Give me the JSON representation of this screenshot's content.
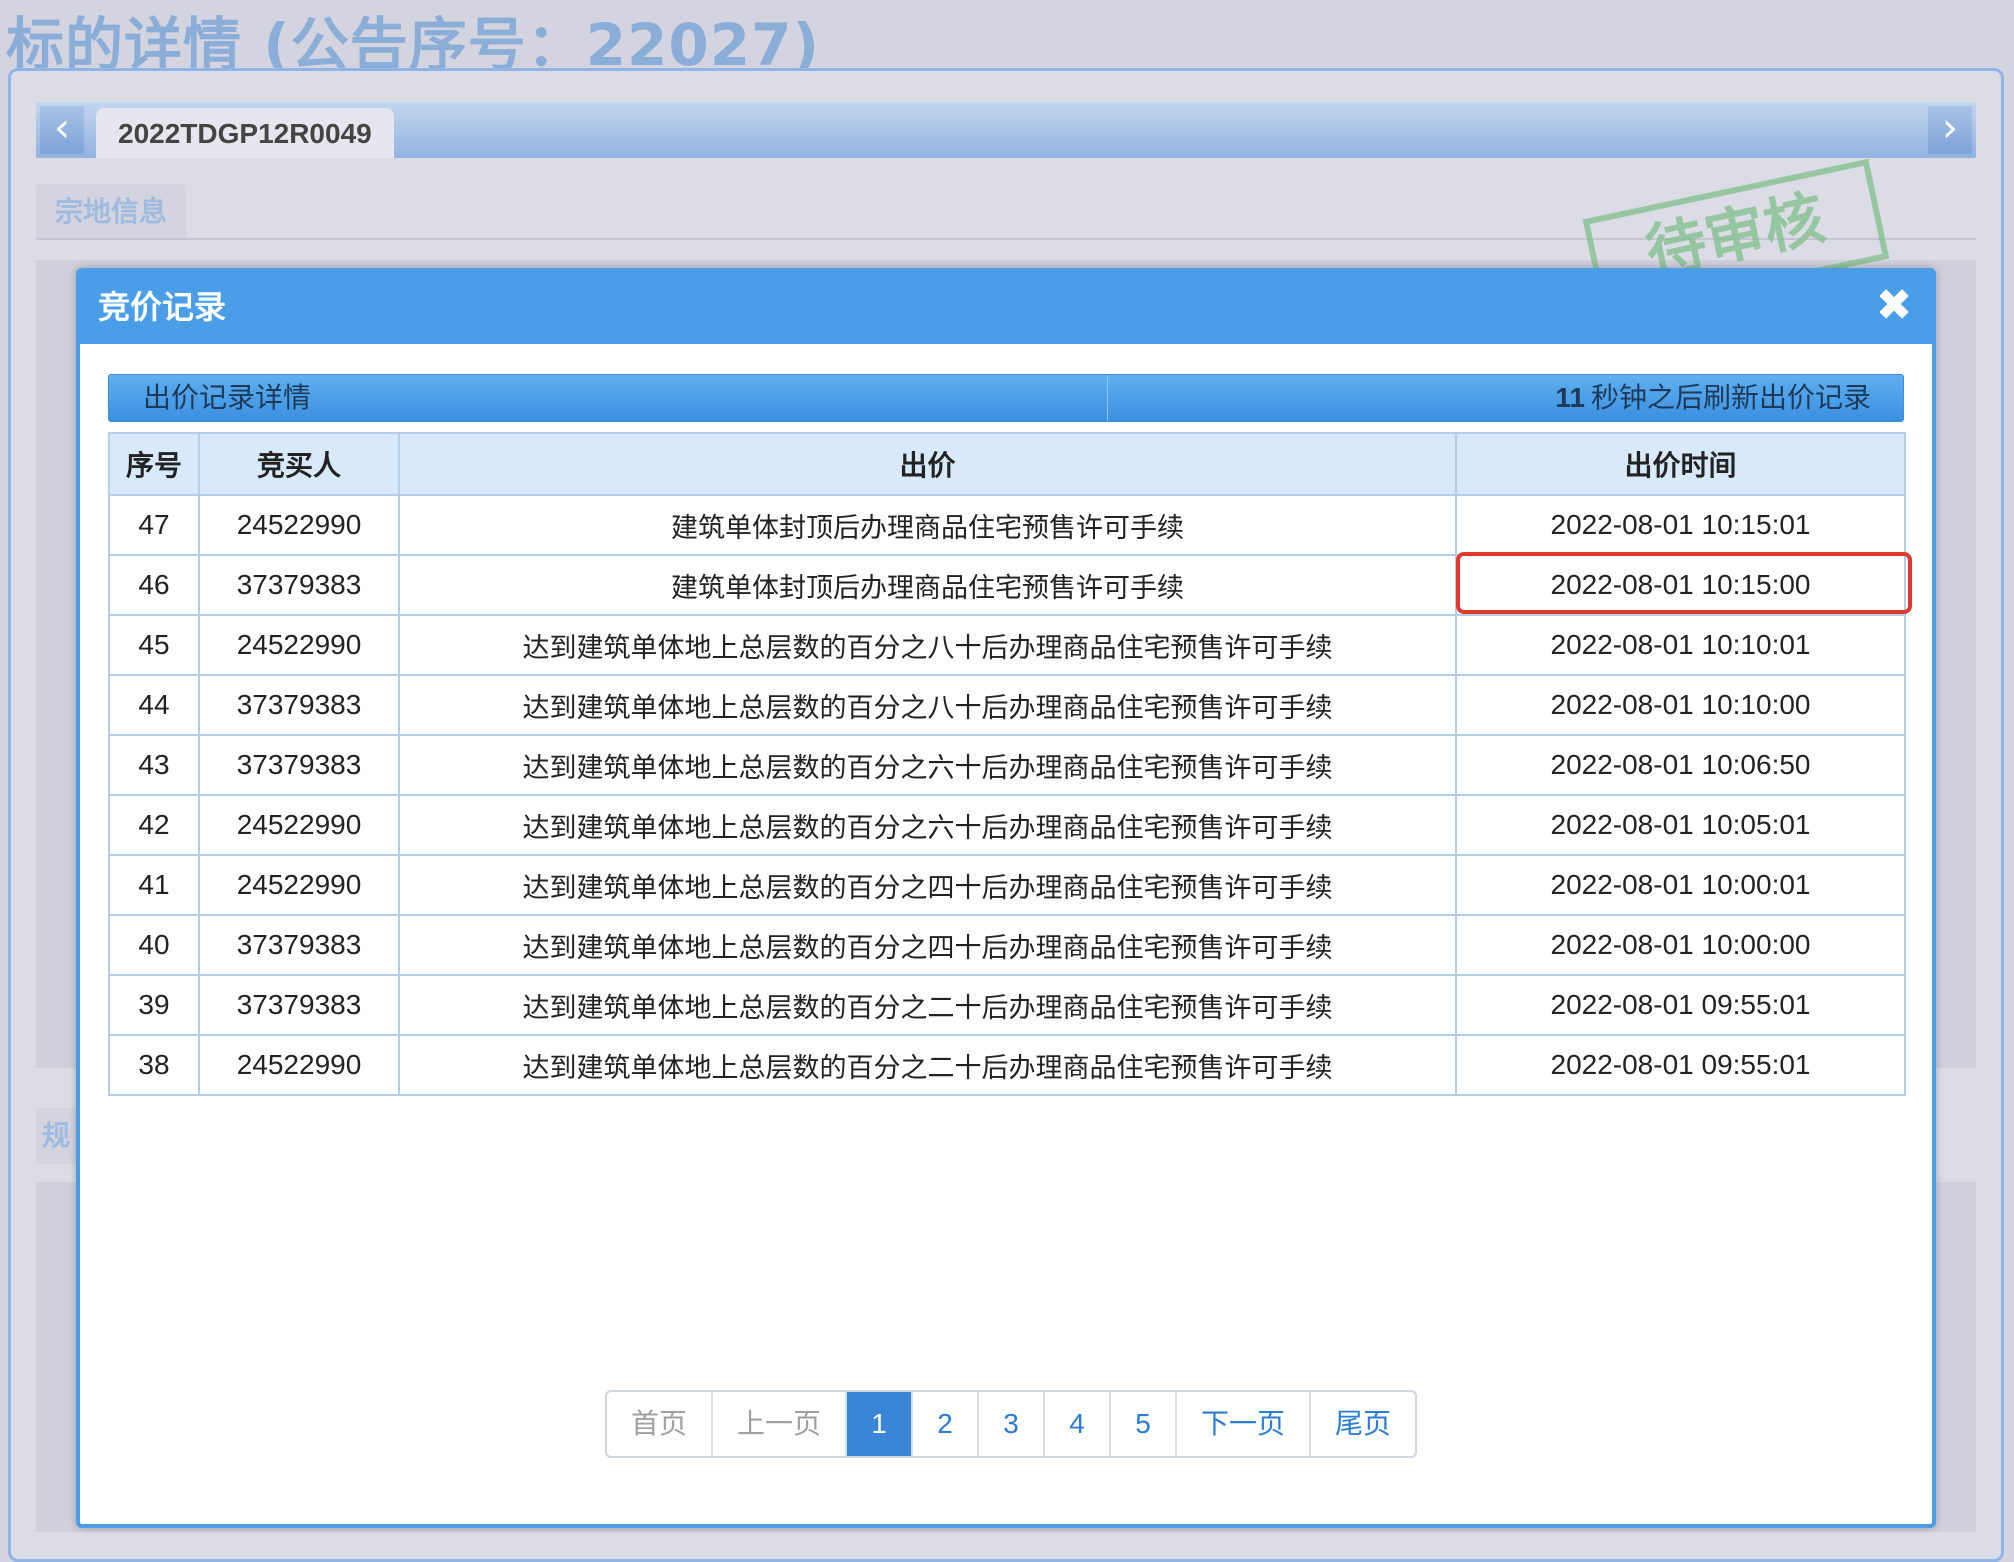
{
  "page": {
    "title": "标的详情 (公告序号：22027)",
    "tab_label": "2022TDGP12R0049",
    "section_land": "宗地信息",
    "section_plan": "规",
    "stamp_text": "待审核"
  },
  "modal": {
    "title": "竞价记录",
    "close_icon": "close-icon",
    "records_title": "出价记录详情",
    "refresh_count": "11",
    "refresh_text": "秒钟之后刷新出价记录"
  },
  "table": {
    "headers": [
      "序号",
      "竞买人",
      "出价",
      "出价时间"
    ],
    "rows": [
      {
        "no": "47",
        "bidder": "24522990",
        "price": "建筑单体封顶后办理商品住宅预售许可手续",
        "time": "2022-08-01 10:15:01"
      },
      {
        "no": "46",
        "bidder": "37379383",
        "price": "建筑单体封顶后办理商品住宅预售许可手续",
        "time": "2022-08-01 10:15:00"
      },
      {
        "no": "45",
        "bidder": "24522990",
        "price": "达到建筑单体地上总层数的百分之八十后办理商品住宅预售许可手续",
        "time": "2022-08-01 10:10:01"
      },
      {
        "no": "44",
        "bidder": "37379383",
        "price": "达到建筑单体地上总层数的百分之八十后办理商品住宅预售许可手续",
        "time": "2022-08-01 10:10:00"
      },
      {
        "no": "43",
        "bidder": "37379383",
        "price": "达到建筑单体地上总层数的百分之六十后办理商品住宅预售许可手续",
        "time": "2022-08-01 10:06:50"
      },
      {
        "no": "42",
        "bidder": "24522990",
        "price": "达到建筑单体地上总层数的百分之六十后办理商品住宅预售许可手续",
        "time": "2022-08-01 10:05:01"
      },
      {
        "no": "41",
        "bidder": "24522990",
        "price": "达到建筑单体地上总层数的百分之四十后办理商品住宅预售许可手续",
        "time": "2022-08-01 10:00:01"
      },
      {
        "no": "40",
        "bidder": "37379383",
        "price": "达到建筑单体地上总层数的百分之四十后办理商品住宅预售许可手续",
        "time": "2022-08-01 10:00:00"
      },
      {
        "no": "39",
        "bidder": "37379383",
        "price": "达到建筑单体地上总层数的百分之二十后办理商品住宅预售许可手续",
        "time": "2022-08-01 09:55:01"
      },
      {
        "no": "38",
        "bidder": "24522990",
        "price": "达到建筑单体地上总层数的百分之二十后办理商品住宅预售许可手续",
        "time": "2022-08-01 09:55:01"
      }
    ]
  },
  "pagination": {
    "first": "首页",
    "prev": "上一页",
    "pages": [
      "1",
      "2",
      "3",
      "4",
      "5"
    ],
    "current": "1",
    "next": "下一页",
    "last": "尾页"
  },
  "colors": {
    "accent": "#4a9ee8",
    "highlight_border": "#e03a2e",
    "active_page": "#3a86d6"
  }
}
